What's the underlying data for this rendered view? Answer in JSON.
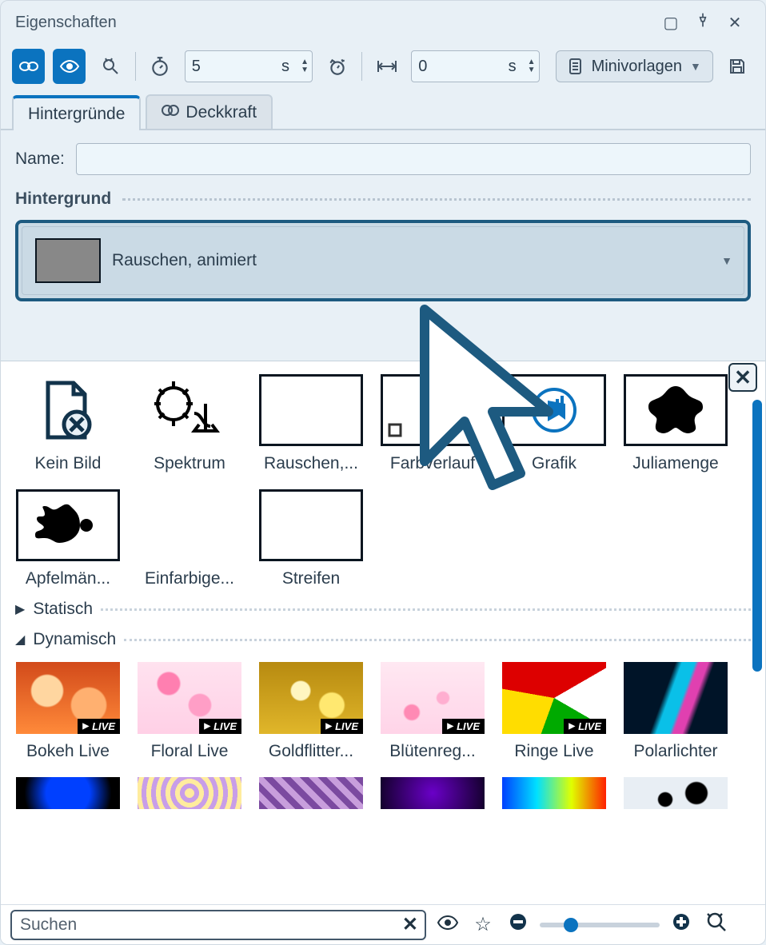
{
  "window": {
    "title": "Eigenschaften"
  },
  "toolbar": {
    "duration_value": "5",
    "duration_unit": "s",
    "gap_value": "0",
    "gap_unit": "s",
    "templates_label": "Minivorlagen"
  },
  "tabs": {
    "backgrounds": "Hintergründe",
    "opacity": "Deckkraft"
  },
  "form": {
    "name_label": "Name:",
    "name_value": "",
    "group_title": "Hintergrund",
    "selected_background": "Rauschen, animiert"
  },
  "picker": {
    "items_top": [
      {
        "label": "Kein Bild"
      },
      {
        "label": "Spektrum"
      },
      {
        "label": "Rauschen,..."
      },
      {
        "label": "Farbverlauf"
      },
      {
        "label": "Grafik"
      },
      {
        "label": "Juliamenge"
      },
      {
        "label": "Apfelmän..."
      },
      {
        "label": "Einfarbige..."
      },
      {
        "label": "Streifen"
      }
    ],
    "section_static": "Statisch",
    "section_dynamic": "Dynamisch",
    "items_dynamic": [
      {
        "label": "Bokeh Live",
        "live": true
      },
      {
        "label": "Floral Live",
        "live": true
      },
      {
        "label": "Goldflitter...",
        "live": true
      },
      {
        "label": "Blütenreg...",
        "live": true
      },
      {
        "label": "Ringe Live",
        "live": true
      },
      {
        "label": "Polarlichter",
        "live": false
      }
    ],
    "live_badge": "LIVE"
  },
  "bottombar": {
    "search_placeholder": "Suchen"
  }
}
